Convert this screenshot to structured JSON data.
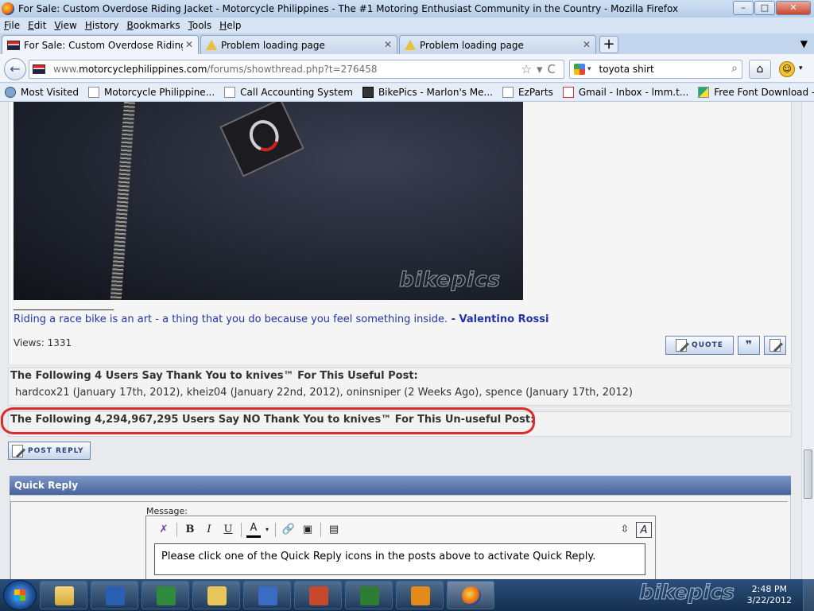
{
  "window": {
    "title": "For Sale: Custom Overdose Riding Jacket - Motorcycle Philippines - The #1 Motoring Enthusiast Community in the Country - Mozilla Firefox",
    "min": "–",
    "max": "□",
    "close": "✕"
  },
  "menu": [
    "File",
    "Edit",
    "View",
    "History",
    "Bookmarks",
    "Tools",
    "Help"
  ],
  "tabs": [
    {
      "label": "For Sale: Custom Overdose Riding Jac...",
      "close": "✕"
    },
    {
      "label": "Problem loading page",
      "close": "✕"
    },
    {
      "label": "Problem loading page",
      "close": "✕"
    }
  ],
  "tabbar": {
    "new_tab": "+",
    "list": "▼"
  },
  "nav": {
    "back": "←",
    "url_prefix": "www.",
    "url_domain": "motorcyclephilippines.com",
    "url_path": "/forums/showthread.php?t=276458",
    "url_icons": "☆▾C",
    "search_value": "toyota shirt",
    "search_icon": "⌕",
    "home": "⌂",
    "caret": "▾"
  },
  "bookmarks": [
    "Most Visited",
    "Motorcycle Philippine...",
    "Call Accounting System",
    "BikePics - Marlon's Me...",
    "EzParts",
    "Gmail - Inbox - lmm.t...",
    "Free Font Download - ..."
  ],
  "post": {
    "photo_watermark": "bikepics",
    "signature_quote": "Riding a race bike is an art - a thing that you do because you feel something inside.",
    "signature_sep": " - ",
    "signature_author": "Valentino Rossi",
    "views_label": "Views: 1331",
    "quote_button": "QUOTE",
    "multiquote_icon": "❞"
  },
  "thanks": {
    "yes_heading": "The Following 4 Users Say Thank You to knives™ For This Useful Post:",
    "yes_list": "hardcox21 (January 17th, 2012), kheiz04 (January 22nd, 2012), oninsniper (2 Weeks Ago), spence (January 17th, 2012)",
    "no_heading": "The Following 4,294,967,295 Users Say NO Thank You to knives™ For This Un-useful Post:"
  },
  "post_reply_button": "POST REPLY",
  "quick_reply": {
    "title": "Quick Reply",
    "message_label": "Message:",
    "toolbar": {
      "bold": "B",
      "italic": "I",
      "underline": "U",
      "color": "A",
      "resize": "⇳",
      "switch": "A"
    },
    "editor_text": "Please click one of the Quick Reply icons in the posts above to activate Quick Reply."
  },
  "taskbar": {
    "watermark": "bikepics",
    "time": "2:48 PM",
    "date": "3/22/2012"
  },
  "colors": {
    "accent": "#46649c",
    "signature": "#2233aa",
    "highlight_circle": "#e02a2a"
  }
}
